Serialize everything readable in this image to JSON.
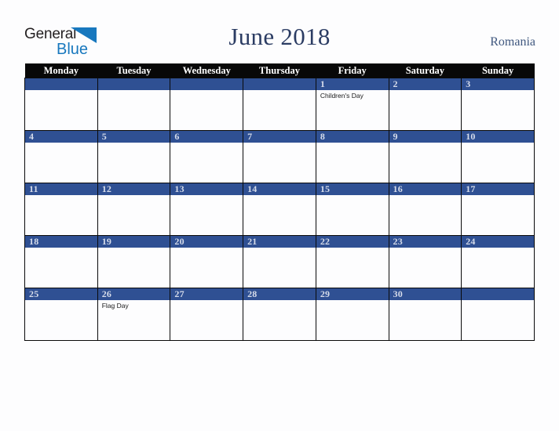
{
  "brand": {
    "line1": "General",
    "line2": "Blue",
    "triangle_color": "#1878be",
    "line1_color": "#231f20",
    "line2_color": "#1878be"
  },
  "header": {
    "title": "June 2018",
    "country": "Romania",
    "title_color": "#2b3c63",
    "country_color": "#40587f"
  },
  "calendar": {
    "weekday_headers": [
      "Monday",
      "Tuesday",
      "Wednesday",
      "Thursday",
      "Friday",
      "Saturday",
      "Sunday"
    ],
    "header_bg": "#080808",
    "header_text_color": "#ffffff",
    "daybar_bg": "#2f5093",
    "daybar_text_color": "#d6dcea",
    "cell_bg": "#fdfdfe",
    "border_color": "#0a0a0a",
    "weeks": [
      [
        {
          "day": "",
          "events": []
        },
        {
          "day": "",
          "events": []
        },
        {
          "day": "",
          "events": []
        },
        {
          "day": "",
          "events": []
        },
        {
          "day": "1",
          "events": [
            "Children's Day"
          ]
        },
        {
          "day": "2",
          "events": []
        },
        {
          "day": "3",
          "events": []
        }
      ],
      [
        {
          "day": "4",
          "events": []
        },
        {
          "day": "5",
          "events": []
        },
        {
          "day": "6",
          "events": []
        },
        {
          "day": "7",
          "events": []
        },
        {
          "day": "8",
          "events": []
        },
        {
          "day": "9",
          "events": []
        },
        {
          "day": "10",
          "events": []
        }
      ],
      [
        {
          "day": "11",
          "events": []
        },
        {
          "day": "12",
          "events": []
        },
        {
          "day": "13",
          "events": []
        },
        {
          "day": "14",
          "events": []
        },
        {
          "day": "15",
          "events": []
        },
        {
          "day": "16",
          "events": []
        },
        {
          "day": "17",
          "events": []
        }
      ],
      [
        {
          "day": "18",
          "events": []
        },
        {
          "day": "19",
          "events": []
        },
        {
          "day": "20",
          "events": []
        },
        {
          "day": "21",
          "events": []
        },
        {
          "day": "22",
          "events": []
        },
        {
          "day": "23",
          "events": []
        },
        {
          "day": "24",
          "events": []
        }
      ],
      [
        {
          "day": "25",
          "events": []
        },
        {
          "day": "26",
          "events": [
            "Flag Day"
          ]
        },
        {
          "day": "27",
          "events": []
        },
        {
          "day": "28",
          "events": []
        },
        {
          "day": "29",
          "events": []
        },
        {
          "day": "30",
          "events": []
        },
        {
          "day": "",
          "events": []
        }
      ]
    ]
  }
}
